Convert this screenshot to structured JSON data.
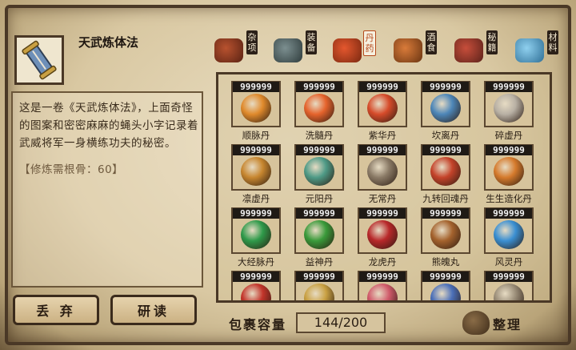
{
  "item": {
    "title": "天武炼体法",
    "description": "这是一卷《天武炼体法》，上面奇怪的图案和密密麻麻的蝇头小字记录着武威将军一身横练功夫的秘密。",
    "requirement": "【修炼需根骨：60】"
  },
  "buttons": {
    "discard": "丢 弃",
    "study": "研读",
    "sort": "整理"
  },
  "tabs": [
    {
      "label": "杂项",
      "icon": "jar-icon"
    },
    {
      "label": "装备",
      "icon": "equipment-icon"
    },
    {
      "label": "丹药",
      "icon": "elixir-icon"
    },
    {
      "label": "酒食",
      "icon": "food-icon"
    },
    {
      "label": "秘籍",
      "icon": "manual-icon"
    },
    {
      "label": "材料",
      "icon": "crystal-icon"
    }
  ],
  "active_tab": "丹药",
  "inventory": [
    {
      "qty": "999999",
      "name": "顺脉丹",
      "color": "#e08a2c"
    },
    {
      "qty": "999999",
      "name": "洗髓丹",
      "color": "#e5632c"
    },
    {
      "qty": "999999",
      "name": "紫华丹",
      "color": "#d64b2a"
    },
    {
      "qty": "999999",
      "name": "坎离丹",
      "color": "#4d86b8"
    },
    {
      "qty": "999999",
      "name": "碎虚丹",
      "color": "#b8b0a4"
    },
    {
      "qty": "999999",
      "name": "凛虚丹",
      "color": "#c7862f"
    },
    {
      "qty": "999999",
      "name": "元阳丹",
      "color": "#4e9a86"
    },
    {
      "qty": "999999",
      "name": "无常丹",
      "color": "#8a7a66"
    },
    {
      "qty": "999999",
      "name": "九转回魂丹",
      "color": "#c4432a"
    },
    {
      "qty": "999999",
      "name": "生生造化丹",
      "color": "#d57a2c"
    },
    {
      "qty": "999999",
      "name": "大经脉丹",
      "color": "#2f9a4a"
    },
    {
      "qty": "999999",
      "name": "益神丹",
      "color": "#3a9a3a"
    },
    {
      "qty": "999999",
      "name": "龙虎丹",
      "color": "#b8282a"
    },
    {
      "qty": "999999",
      "name": "熊魄丸",
      "color": "#a4622d"
    },
    {
      "qty": "999999",
      "name": "风灵丹",
      "color": "#3a8fd2"
    },
    {
      "qty": "999999",
      "name": "",
      "color": "#c2342a"
    },
    {
      "qty": "999999",
      "name": "",
      "color": "#c9a042"
    },
    {
      "qty": "999999",
      "name": "",
      "color": "#d05a6a"
    },
    {
      "qty": "999999",
      "name": "",
      "color": "#4b6fb8"
    },
    {
      "qty": "999999",
      "name": "",
      "color": "#9a8d78"
    }
  ],
  "capacity": {
    "label": "包裹容量",
    "value": "144/200"
  }
}
